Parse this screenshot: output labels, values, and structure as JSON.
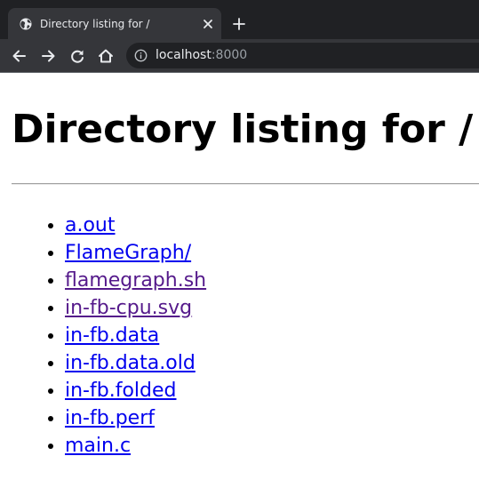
{
  "tab": {
    "title": "Directory listing for /",
    "favicon": "globe-icon"
  },
  "toolbar": {
    "url_host": "localhost",
    "url_port": ":8000"
  },
  "page": {
    "heading": "Directory listing for /",
    "files": [
      {
        "name": "a.out",
        "visited": false
      },
      {
        "name": "FlameGraph/",
        "visited": false
      },
      {
        "name": "flamegraph.sh",
        "visited": true
      },
      {
        "name": "in-fb-cpu.svg",
        "visited": true
      },
      {
        "name": "in-fb.data",
        "visited": false
      },
      {
        "name": "in-fb.data.old",
        "visited": false
      },
      {
        "name": "in-fb.folded",
        "visited": false
      },
      {
        "name": "in-fb.perf",
        "visited": false
      },
      {
        "name": "main.c",
        "visited": false
      }
    ]
  },
  "colors": {
    "link": "#0000ee",
    "visited_link": "#551a8b",
    "chrome_dark": "#202124",
    "chrome_tab": "#35363a"
  }
}
